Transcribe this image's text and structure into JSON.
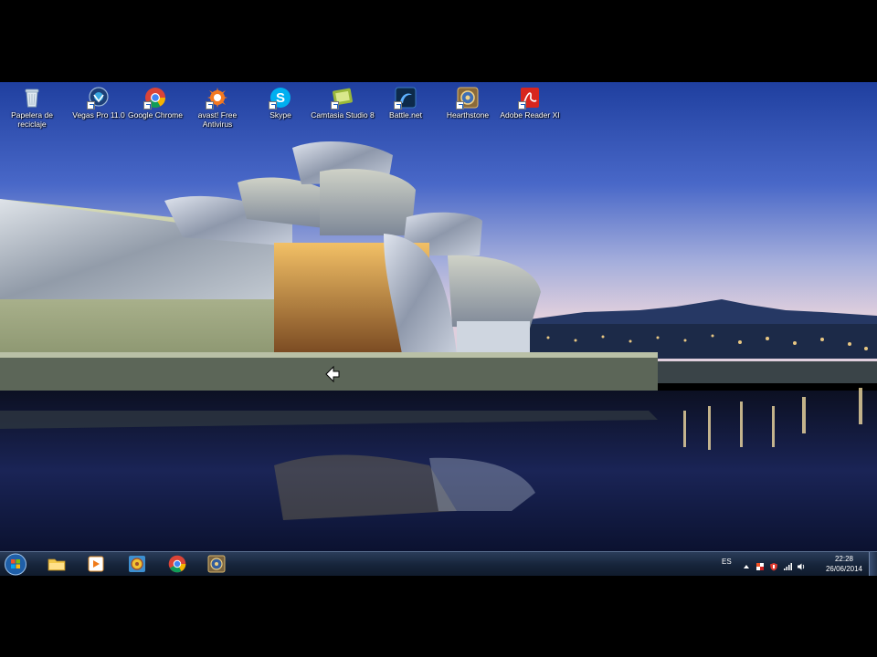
{
  "desktop": {
    "icons": [
      {
        "label": "Papelera de reciclaje",
        "icon": "recycle-bin-icon"
      },
      {
        "label": "Vegas Pro 11.0",
        "icon": "vegas-pro-icon"
      },
      {
        "label": "Google Chrome",
        "icon": "chrome-icon"
      },
      {
        "label": "avast! Free Antivirus",
        "icon": "avast-icon"
      },
      {
        "label": "Skype",
        "icon": "skype-icon"
      },
      {
        "label": "Camtasia Studio 8",
        "icon": "camtasia-icon"
      },
      {
        "label": "Battle.net",
        "icon": "battlenet-icon"
      },
      {
        "label": "Hearthstone",
        "icon": "hearthstone-icon"
      },
      {
        "label": "Adobe Reader XI",
        "icon": "adobe-reader-icon"
      }
    ]
  },
  "taskbar": {
    "pinned": [
      "windows-start-icon",
      "file-explorer-icon",
      "media-player-icon",
      "hearthstone-icon",
      "chrome-icon",
      "hearthstone-launcher-icon"
    ],
    "tray": {
      "language": "ES",
      "icons": [
        "show-hidden-icons-icon",
        "action-center-flag-icon",
        "security-shield-icon",
        "network-signal-icon",
        "volume-icon"
      ],
      "time": "22:28",
      "date": "26/06/2014"
    }
  },
  "colors": {
    "taskbar": "#16243a",
    "sky_top": "#2c4fb0",
    "sky_horizon": "#d9c7d8",
    "water": "#0b1230"
  }
}
